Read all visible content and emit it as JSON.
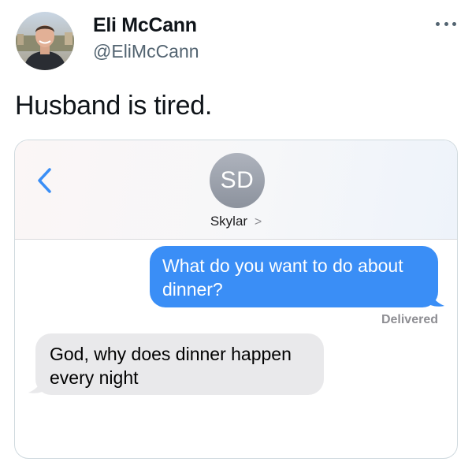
{
  "tweet": {
    "author_name": "Eli McCann",
    "author_handle": "@EliMcCann",
    "text": "Husband is tired.",
    "more_icon": "more-horizontal-icon"
  },
  "imessage": {
    "back_icon": "chevron-left-icon",
    "contact_initials": "SD",
    "contact_name": "Skylar",
    "contact_chevron": ">",
    "messages": [
      {
        "direction": "sent",
        "text": "What do you want to do about dinner?"
      },
      {
        "direction": "received",
        "text": "God, why does dinner happen every night"
      }
    ],
    "delivered_label": "Delivered"
  },
  "colors": {
    "sent_bubble": "#3a8ef6",
    "received_bubble": "#e9e9eb",
    "ios_blue": "#3a8ef6",
    "handle_gray": "#536471"
  }
}
